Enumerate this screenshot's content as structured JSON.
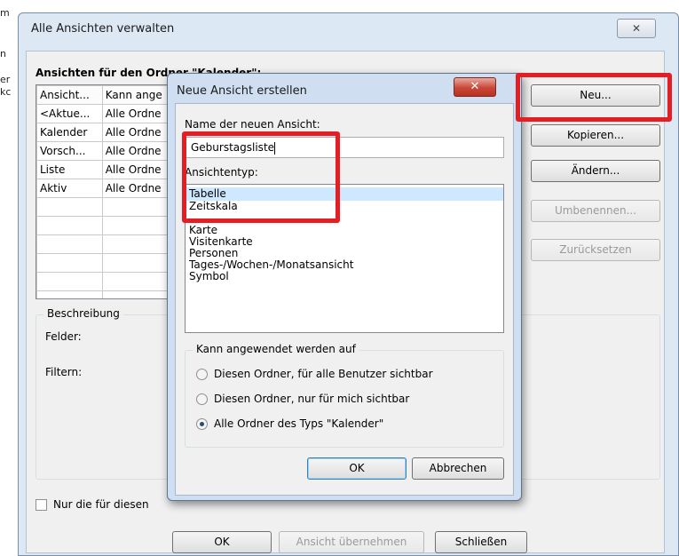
{
  "background": {
    "fragments": [
      "m",
      "n",
      "er",
      "kc"
    ]
  },
  "outer_dialog": {
    "title": "Alle Ansichten verwalten",
    "close_glyph": "✕",
    "views_label": "Ansichten für den Ordner \"Kalender\":",
    "table": {
      "columns": [
        "Ansicht...",
        "Kann ange"
      ],
      "rows": [
        [
          "<Aktue...",
          "Alle Ordne"
        ],
        [
          "Kalender",
          "Alle Ordne"
        ],
        [
          "Vorsch...",
          "Alle Ordne"
        ],
        [
          "Liste",
          "Alle Ordne"
        ],
        [
          "Aktiv",
          "Alle Ordne"
        ]
      ]
    },
    "buttons": {
      "new": "Neu...",
      "copy": "Kopieren...",
      "modify": "Ändern...",
      "rename": "Umbenennen...",
      "reset": "Zurücksetzen"
    },
    "description": {
      "title": "Beschreibung",
      "fields_label": "Felder:",
      "filter_label": "Filtern:"
    },
    "only_checkbox_label": "Nur die für diesen",
    "footer": {
      "ok": "OK",
      "apply": "Ansicht übernehmen",
      "close": "Schließen"
    }
  },
  "inner_dialog": {
    "title": "Neue Ansicht erstellen",
    "close_glyph": "✕",
    "name_label": "Name der neuen Ansicht:",
    "name_value": "Geburstagsliste",
    "type_label": "Ansichtentyp:",
    "types": [
      "Tabelle",
      "Zeitskala",
      "Karte",
      "Visitenkarte",
      "Personen",
      "Tages-/Wochen-/Monatsansicht",
      "Symbol"
    ],
    "selected_type": "Tabelle",
    "apply_group": {
      "title": "Kann angewendet werden auf",
      "options": [
        "Diesen Ordner, für alle Benutzer sichtbar",
        "Diesen Ordner, nur für mich sichtbar",
        "Alle Ordner des Typs \"Kalender\""
      ],
      "selected_option": "Alle Ordner des Typs \"Kalender\""
    },
    "ok": "OK",
    "cancel": "Abbrechen"
  },
  "highlights": {
    "color": "#e31e24"
  }
}
